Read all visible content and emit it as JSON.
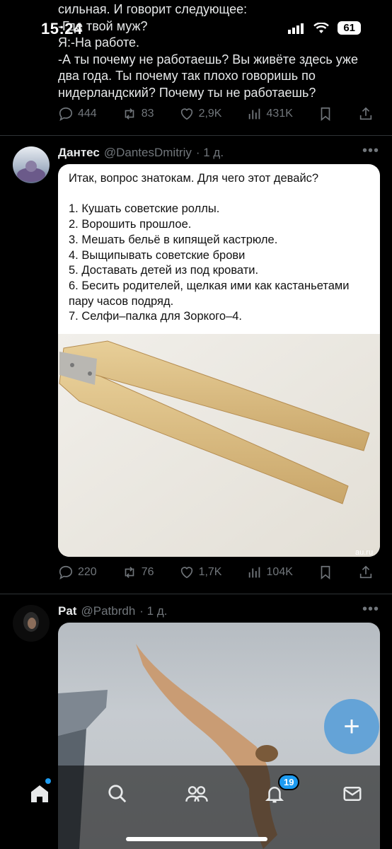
{
  "status_bar": {
    "time": "15:24",
    "battery": "61"
  },
  "prev_tweet": {
    "lines": [
      "сильная. И говорит следующее:",
      "-Где твой муж?",
      "Я:-На работе.",
      "-А ты почему не  работаешь? Вы живёте здесь уже",
      "два года. Ты почему так плохо говоришь по",
      "нидерландский? Почему ты не работаешь?"
    ],
    "stats": {
      "replies": "444",
      "reposts": "83",
      "likes": "2,9K",
      "views": "431K"
    }
  },
  "tweet1": {
    "name": "Дантес",
    "handle": "@DantesDmitriy",
    "time": "· 1 д.",
    "card_lines": [
      "Итак, вопрос знатокам. Для чего этот девайс?",
      "",
      "1. Кушать советские роллы.",
      "2. Ворошить прошлое.",
      "3. Мешать бельё в кипящей кастрюле.",
      "4. Выщипывать советские брови",
      "5. Доставать детей из под кровати.",
      "6. Бесить родителей, щелкая ими как кастаньетами",
      "пару часов подряд.",
      "7. Селфи–палка для Зоркого–4."
    ],
    "watermark": "au.ru",
    "stats": {
      "replies": "220",
      "reposts": "76",
      "likes": "1,7K",
      "views": "104K"
    }
  },
  "tweet2": {
    "name": "Pat",
    "handle": "@Patbrdh",
    "time": "· 1 д."
  },
  "tabbar": {
    "notifications_badge": "19"
  },
  "colors": {
    "accent": "#1d9bf0",
    "muted": "#71767b",
    "background": "#000000"
  },
  "icons": [
    "reply-icon",
    "repost-icon",
    "like-icon",
    "views-icon",
    "bookmark-icon",
    "share-icon",
    "home-icon",
    "search-icon",
    "communities-icon",
    "bell-icon",
    "mail-icon",
    "compose-icon"
  ]
}
